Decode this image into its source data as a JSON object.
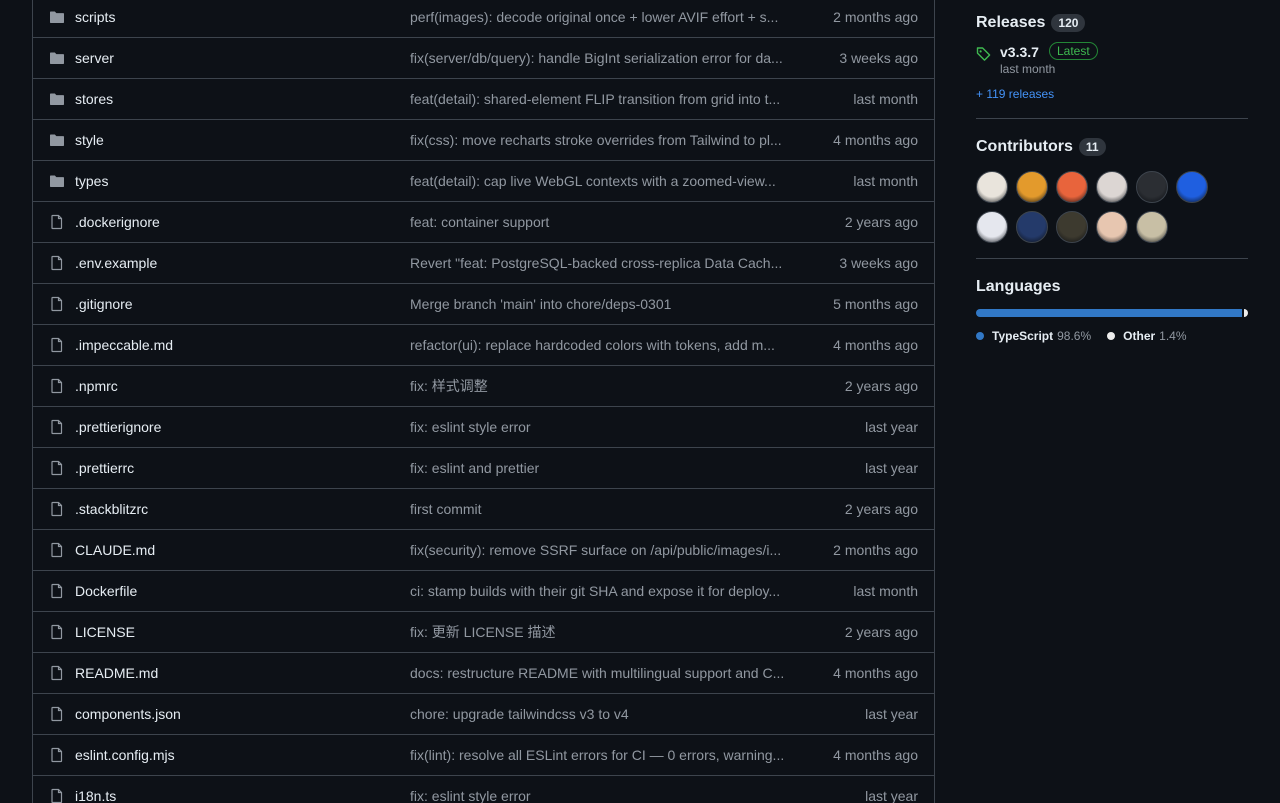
{
  "files": [
    {
      "type": "folder",
      "name": "scripts",
      "message": "perf(images): decode original once + lower AVIF effort + s...",
      "age": "2 months ago"
    },
    {
      "type": "folder",
      "name": "server",
      "message": "fix(server/db/query): handle BigInt serialization error for da...",
      "age": "3 weeks ago"
    },
    {
      "type": "folder",
      "name": "stores",
      "message": "feat(detail): shared-element FLIP transition from grid into t...",
      "age": "last month"
    },
    {
      "type": "folder",
      "name": "style",
      "message": "fix(css): move recharts stroke overrides from Tailwind to pl...",
      "age": "4 months ago"
    },
    {
      "type": "folder",
      "name": "types",
      "message": "feat(detail): cap live WebGL contexts with a zoomed-view...",
      "age": "last month"
    },
    {
      "type": "file",
      "name": ".dockerignore",
      "message": "feat: container support",
      "age": "2 years ago"
    },
    {
      "type": "file",
      "name": ".env.example",
      "message": "Revert \"feat: PostgreSQL-backed cross-replica Data Cach...",
      "age": "3 weeks ago"
    },
    {
      "type": "file",
      "name": ".gitignore",
      "message": "Merge branch 'main' into chore/deps-0301",
      "age": "5 months ago"
    },
    {
      "type": "file",
      "name": ".impeccable.md",
      "message": "refactor(ui): replace hardcoded colors with tokens, add m...",
      "age": "4 months ago"
    },
    {
      "type": "file",
      "name": ".npmrc",
      "message": "fix: 样式调整",
      "age": "2 years ago"
    },
    {
      "type": "file",
      "name": ".prettierignore",
      "message": "fix: eslint style error",
      "age": "last year"
    },
    {
      "type": "file",
      "name": ".prettierrc",
      "message": "fix: eslint and prettier",
      "age": "last year"
    },
    {
      "type": "file",
      "name": ".stackblitzrc",
      "message": "first commit",
      "age": "2 years ago"
    },
    {
      "type": "file",
      "name": "CLAUDE.md",
      "message": "fix(security): remove SSRF surface on /api/public/images/i...",
      "age": "2 months ago"
    },
    {
      "type": "file",
      "name": "Dockerfile",
      "message": "ci: stamp builds with their git SHA and expose it for deploy...",
      "age": "last month"
    },
    {
      "type": "file",
      "name": "LICENSE",
      "message": "fix: 更新 LICENSE 描述",
      "age": "2 years ago"
    },
    {
      "type": "file",
      "name": "README.md",
      "message": "docs: restructure README with multilingual support and C...",
      "age": "4 months ago"
    },
    {
      "type": "file",
      "name": "components.json",
      "message": "chore: upgrade tailwindcss v3 to v4",
      "age": "last year"
    },
    {
      "type": "file",
      "name": "eslint.config.mjs",
      "message": "fix(lint): resolve all ESLint errors for CI — 0 errors, warning...",
      "age": "4 months ago"
    },
    {
      "type": "file",
      "name": "i18n.ts",
      "message": "fix: eslint style error",
      "age": "last year"
    }
  ],
  "releases": {
    "title": "Releases",
    "count": "120",
    "latest_version": "v3.3.7",
    "latest_badge": "Latest",
    "latest_date": "last month",
    "more_link": "+ 119 releases"
  },
  "contributors": {
    "title": "Contributors",
    "count": "11",
    "avatar_colors": [
      "#e9e4dc",
      "#e39a2c",
      "#e8643c",
      "#dcd6d3",
      "#2b2e33",
      "#1f5fe0",
      "#e5e7ee",
      "#243a6a",
      "#3d3a2f",
      "#e7c6b0",
      "#c8bfa5"
    ]
  },
  "languages": {
    "title": "Languages",
    "items": [
      {
        "name": "TypeScript",
        "percent": "98.6%",
        "value": 98.6,
        "color": "#3178c6"
      },
      {
        "name": "Other",
        "percent": "1.4%",
        "value": 1.4,
        "color": "#ededed"
      }
    ]
  }
}
